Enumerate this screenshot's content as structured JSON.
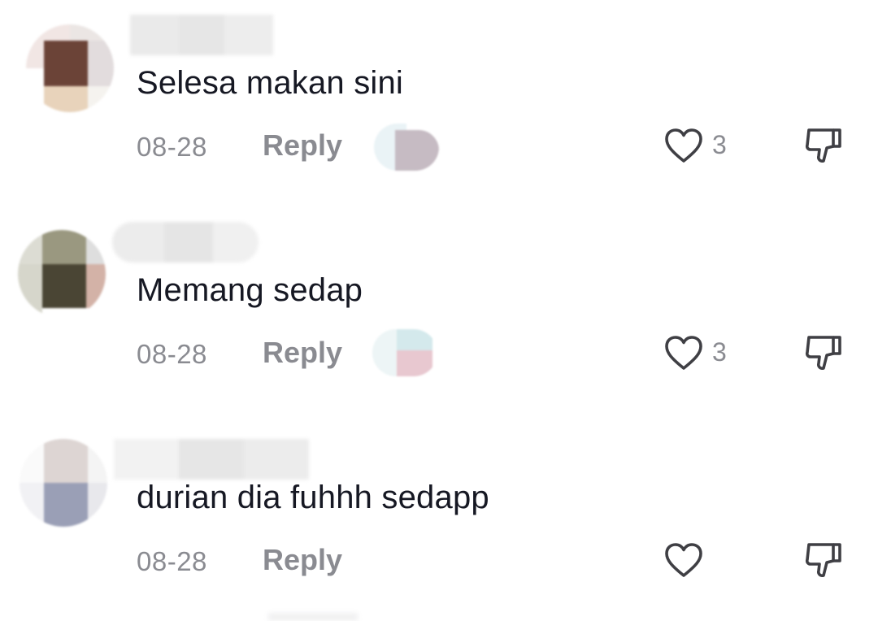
{
  "comments": [
    {
      "text": "Selesa makan sini",
      "date": "08-28",
      "reply_label": "Reply",
      "like_count": "3",
      "avatar_colors": [
        "#f1e6e4",
        "#ebe6e4",
        "#6b4337",
        "#e2dcdd",
        "#e8d3bb",
        "#f5f3ef"
      ],
      "liker_colors": [
        "#eaf3f6",
        "#c6bbc3",
        "#dbe9ee",
        "#bfb6bf"
      ]
    },
    {
      "text": "Memang sedap",
      "date": "08-28",
      "reply_label": "Reply",
      "like_count": "3",
      "avatar_colors": [
        "#dcdcd3",
        "#9a9880",
        "#dedede",
        "#d6d6cb",
        "#4a4534",
        "#d3b2a7"
      ],
      "liker_colors": [
        "#edf5f6",
        "#d4e9ec",
        "#f0f3f4",
        "#e8c8d0"
      ]
    },
    {
      "text": "durian dia fuhhh sedapp",
      "date": "08-28",
      "reply_label": "Reply",
      "like_count": "",
      "avatar_colors": [
        "#fafafa",
        "#ddd5d3",
        "#f4f4f4",
        "#f1f1f4",
        "#9a9fb6",
        "#e8e8ec"
      ],
      "liker_colors": []
    }
  ],
  "icons": {
    "like": "heart-outline-icon",
    "dislike": "thumbs-down-outline-icon"
  },
  "colors": {
    "text": "#161823",
    "meta": "#8a8b91",
    "icon_stroke": "#3f3f44",
    "background": "#ffffff"
  }
}
